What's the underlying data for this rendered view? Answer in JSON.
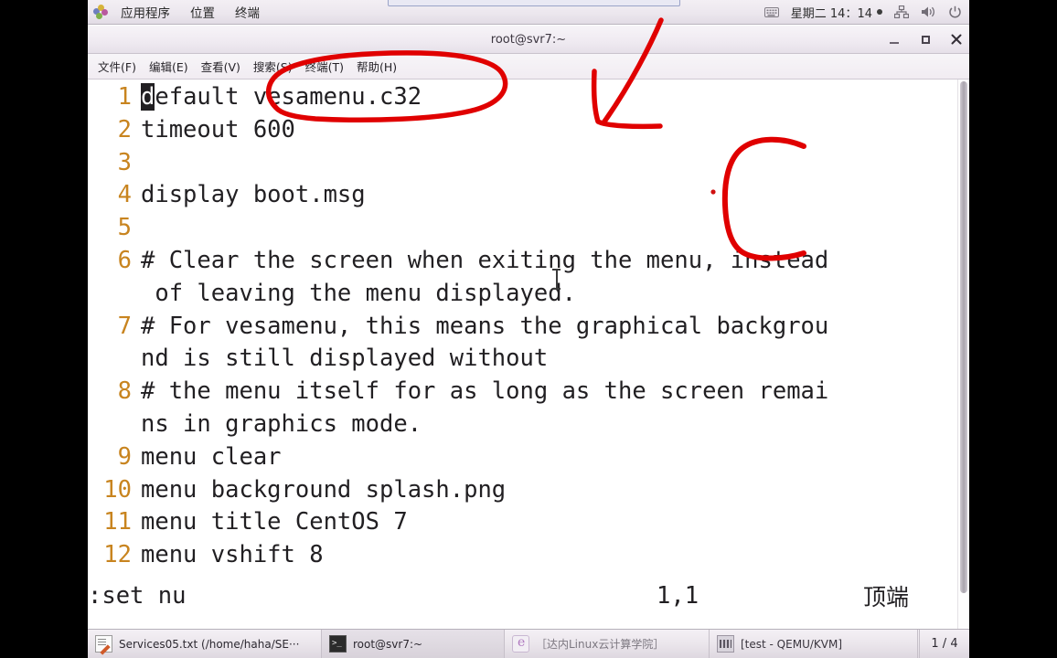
{
  "panel": {
    "apps_label": "应用程序",
    "places_label": "位置",
    "terminal_label": "终端",
    "clock": "星期二 14：14",
    "keyboard_icon": "keyboard-icon",
    "network_icon": "network-icon",
    "volume_icon": "volume-icon",
    "power_icon": "power-icon"
  },
  "window": {
    "title": "root@svr7:~",
    "minimize": "–",
    "maximize": "□",
    "close": "✕",
    "menus": [
      {
        "label": "文件(F)"
      },
      {
        "label": "编辑(E)"
      },
      {
        "label": "查看(V)"
      },
      {
        "label": "搜索(S)"
      },
      {
        "label": "终端(T)"
      },
      {
        "label": "帮助(H)"
      }
    ]
  },
  "terminal": {
    "lines": [
      {
        "num": "1",
        "cursor": "d",
        "text": "efault vesamenu.c32"
      },
      {
        "num": "2",
        "cursor": "",
        "text": "timeout 600"
      },
      {
        "num": "3",
        "cursor": "",
        "text": ""
      },
      {
        "num": "4",
        "cursor": "",
        "text": "display boot.msg"
      },
      {
        "num": "5",
        "cursor": "",
        "text": ""
      },
      {
        "num": "6",
        "cursor": "",
        "text": "# Clear the screen when exiting the menu, instead"
      },
      {
        "num": "",
        "cursor": "",
        "text": " of leaving the menu displayed."
      },
      {
        "num": "7",
        "cursor": "",
        "text": "# For vesamenu, this means the graphical backgrou"
      },
      {
        "num": "",
        "cursor": "",
        "text": "nd is still displayed without"
      },
      {
        "num": "8",
        "cursor": "",
        "text": "# the menu itself for as long as the screen remai"
      },
      {
        "num": "",
        "cursor": "",
        "text": "ns in graphics mode."
      },
      {
        "num": "9",
        "cursor": "",
        "text": "menu clear"
      },
      {
        "num": "10",
        "cursor": "",
        "text": "menu background splash.png"
      },
      {
        "num": "11",
        "cursor": "",
        "text": "menu title CentOS 7"
      },
      {
        "num": "12",
        "cursor": "",
        "text": "menu vshift 8"
      }
    ],
    "status_command": ":set nu",
    "status_position": "1,1",
    "status_location": "顶端"
  },
  "taskbar": {
    "items": [
      {
        "label": "Services05.txt (/home/haha/SE···",
        "icon": "text-editor-icon"
      },
      {
        "label": "root@svr7:~",
        "icon": "terminal-icon"
      },
      {
        "label": "［达内Linux云计算学院］",
        "icon": "browser-icon"
      },
      {
        "label": "[test - QEMU/KVM]",
        "icon": "virtual-machine-icon"
      }
    ],
    "workspace": "1 / 4"
  },
  "annotations": {
    "ellipse_target": "vesamenu.c32",
    "arrow": "down-left-arrow",
    "c_mark": "C",
    "color": "#e00000"
  }
}
